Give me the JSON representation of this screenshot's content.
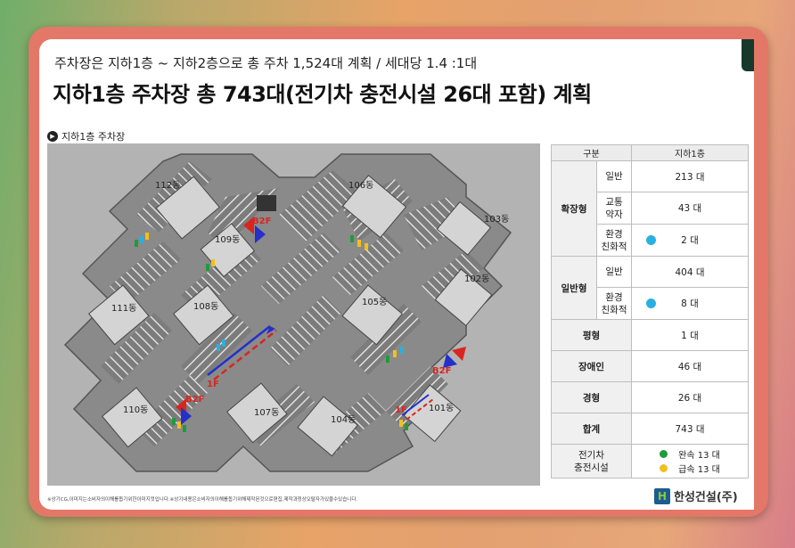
{
  "header": {
    "subtitle": "주차장은 지하1층 ~ 지하2층으로 총 주차 1,524대 계획 / 세대당 1.4 :1대",
    "title": "지하1층 주차장 총 743대(전기차 충전시설 26대 포함) 계획"
  },
  "section": {
    "label": "지하1층 주차장",
    "icon": "play-circle-icon"
  },
  "map": {
    "buildings": [
      "112동",
      "106동",
      "103동",
      "109동",
      "102동",
      "111동",
      "108동",
      "105동",
      "110동",
      "107동",
      "104동",
      "101동"
    ],
    "level_labels": [
      "B2F",
      "B2F",
      "B2F",
      "1F",
      "1F"
    ]
  },
  "table": {
    "header": [
      "구분",
      "지하1층"
    ],
    "groups": [
      {
        "name": "확장형",
        "rows": [
          {
            "label": "일반",
            "value": "213 대",
            "dot": ""
          },
          {
            "label": "교통\n약자",
            "value": "43 대",
            "dot": ""
          },
          {
            "label": "환경\n친화적",
            "value": "2 대",
            "dot": "#2ab0e0"
          }
        ]
      },
      {
        "name": "일반형",
        "rows": [
          {
            "label": "일반",
            "value": "404 대",
            "dot": ""
          },
          {
            "label": "환경\n친화적",
            "value": "8 대",
            "dot": "#2ab0e0"
          }
        ]
      }
    ],
    "single_rows": [
      {
        "label": "평형",
        "value": "1 대"
      },
      {
        "label": "장애인",
        "value": "46 대"
      },
      {
        "label": "경형",
        "value": "26 대"
      },
      {
        "label": "합계",
        "value": "743 대"
      }
    ],
    "ev": {
      "label": "전기차\n충전시설",
      "items": [
        {
          "text": "완속 13 대",
          "color": "#1f9b3a"
        },
        {
          "text": "급속 13 대",
          "color": "#f0c020"
        }
      ]
    }
  },
  "footer": {
    "note": "※상기CG,이미지는소비자의이해를돕기위한이미지컷입니다.※상기내용은소비자의이해를돕기위해제작된것으로편집,제작과정상오탈자가있을수있습니다."
  },
  "logo": {
    "text": "한성건설(주)",
    "mark": "H"
  }
}
